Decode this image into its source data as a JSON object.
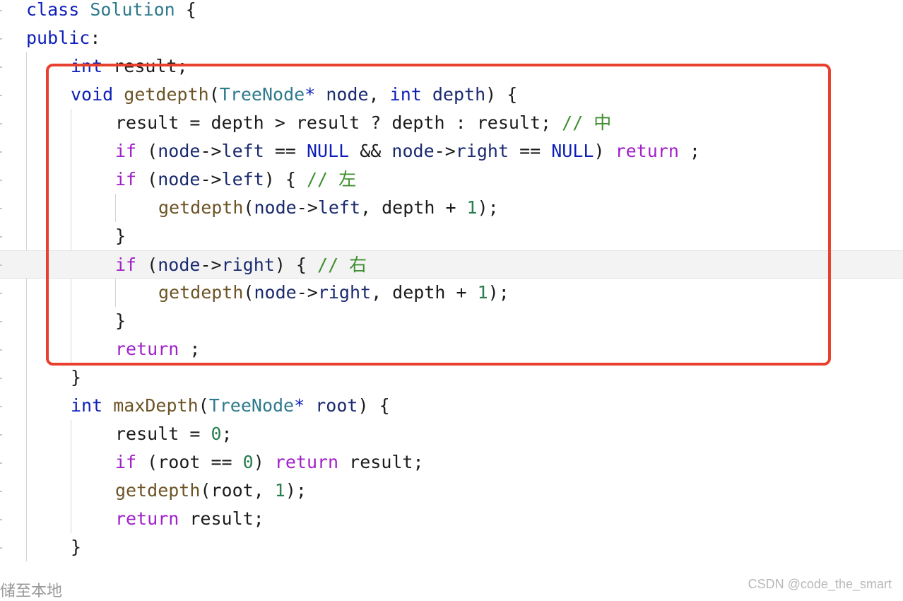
{
  "editor": {
    "lines": [
      {
        "indent": 37,
        "tokens": [
          [
            "kw",
            "class"
          ],
          [
            "op",
            " "
          ],
          [
            "type",
            "Solution"
          ],
          [
            "op",
            " {"
          ]
        ]
      },
      {
        "indent": 37,
        "tokens": [
          [
            "kw",
            "public"
          ],
          [
            "op",
            ":"
          ]
        ]
      },
      {
        "indent": 100,
        "tokens": [
          [
            "kw",
            "int"
          ],
          [
            "op",
            " "
          ],
          [
            "op",
            "result;"
          ]
        ]
      },
      {
        "indent": 100,
        "tokens": [
          [
            "kw",
            "void"
          ],
          [
            "op",
            " "
          ],
          [
            "fn",
            "getdepth"
          ],
          [
            "op",
            "("
          ],
          [
            "type",
            "TreeNode"
          ],
          [
            "kw",
            "*"
          ],
          [
            "op",
            " "
          ],
          [
            "ident",
            "node"
          ],
          [
            "op",
            ", "
          ],
          [
            "kw",
            "int"
          ],
          [
            "op",
            " "
          ],
          [
            "ident",
            "depth"
          ],
          [
            "op",
            ") {"
          ]
        ]
      },
      {
        "indent": 163,
        "tokens": [
          [
            "op",
            "result = depth > result ? depth : result; "
          ],
          [
            "comment",
            "// 中"
          ]
        ]
      },
      {
        "indent": 163,
        "tokens": [
          [
            "ctrl",
            "if"
          ],
          [
            "op",
            " ("
          ],
          [
            "ident",
            "node"
          ],
          [
            "op",
            "->"
          ],
          [
            "ident",
            "left"
          ],
          [
            "op",
            " == "
          ],
          [
            "kw",
            "NULL"
          ],
          [
            "op",
            " && "
          ],
          [
            "ident",
            "node"
          ],
          [
            "op",
            "->"
          ],
          [
            "ident",
            "right"
          ],
          [
            "op",
            " == "
          ],
          [
            "kw",
            "NULL"
          ],
          [
            "op",
            ") "
          ],
          [
            "ctrl",
            "return"
          ],
          [
            "op",
            " ;"
          ]
        ]
      },
      {
        "indent": 163,
        "tokens": [
          [
            "ctrl",
            "if"
          ],
          [
            "op",
            " ("
          ],
          [
            "ident",
            "node"
          ],
          [
            "op",
            "->"
          ],
          [
            "ident",
            "left"
          ],
          [
            "op",
            ") { "
          ],
          [
            "comment",
            "// 左"
          ]
        ]
      },
      {
        "indent": 224,
        "tokens": [
          [
            "fn",
            "getdepth"
          ],
          [
            "op",
            "("
          ],
          [
            "ident",
            "node"
          ],
          [
            "op",
            "->"
          ],
          [
            "ident",
            "left"
          ],
          [
            "op",
            ", depth + "
          ],
          [
            "num",
            "1"
          ],
          [
            "op",
            ");"
          ]
        ]
      },
      {
        "indent": 163,
        "tokens": [
          [
            "op",
            "}"
          ]
        ]
      },
      {
        "indent": 163,
        "current": true,
        "tokens": [
          [
            "ctrl",
            "if"
          ],
          [
            "op",
            " ("
          ],
          [
            "ident",
            "node"
          ],
          [
            "op",
            "->"
          ],
          [
            "ident",
            "right"
          ],
          [
            "op",
            ") { "
          ],
          [
            "comment",
            "// 右"
          ]
        ]
      },
      {
        "indent": 224,
        "tokens": [
          [
            "fn",
            "getdepth"
          ],
          [
            "op",
            "("
          ],
          [
            "ident",
            "node"
          ],
          [
            "op",
            "->"
          ],
          [
            "ident",
            "right"
          ],
          [
            "op",
            ", depth + "
          ],
          [
            "num",
            "1"
          ],
          [
            "op",
            ");"
          ]
        ]
      },
      {
        "indent": 163,
        "tokens": [
          [
            "op",
            "}"
          ]
        ]
      },
      {
        "indent": 163,
        "tokens": [
          [
            "ctrl",
            "return"
          ],
          [
            "op",
            " ;"
          ]
        ]
      },
      {
        "indent": 100,
        "tokens": [
          [
            "op",
            "}"
          ]
        ]
      },
      {
        "indent": 100,
        "tokens": [
          [
            "kw",
            "int"
          ],
          [
            "op",
            " "
          ],
          [
            "fn",
            "maxDepth"
          ],
          [
            "op",
            "("
          ],
          [
            "type",
            "TreeNode"
          ],
          [
            "kw",
            "*"
          ],
          [
            "op",
            " "
          ],
          [
            "ident",
            "root"
          ],
          [
            "op",
            ") {"
          ]
        ]
      },
      {
        "indent": 163,
        "tokens": [
          [
            "op",
            "result = "
          ],
          [
            "num",
            "0"
          ],
          [
            "op",
            ";"
          ]
        ]
      },
      {
        "indent": 163,
        "tokens": [
          [
            "ctrl",
            "if"
          ],
          [
            "op",
            " (root == "
          ],
          [
            "num",
            "0"
          ],
          [
            "op",
            ") "
          ],
          [
            "ctrl",
            "return"
          ],
          [
            "op",
            " result;"
          ]
        ]
      },
      {
        "indent": 163,
        "tokens": [
          [
            "fn",
            "getdepth"
          ],
          [
            "op",
            "(root, "
          ],
          [
            "num",
            "1"
          ],
          [
            "op",
            ");"
          ]
        ]
      },
      {
        "indent": 163,
        "tokens": [
          [
            "ctrl",
            "return"
          ],
          [
            "op",
            " result;"
          ]
        ]
      },
      {
        "indent": 100,
        "tokens": [
          [
            "op",
            "}"
          ]
        ]
      }
    ]
  },
  "footer": {
    "save_text": "储至本地",
    "watermark": "CSDN @code_the_smart"
  }
}
